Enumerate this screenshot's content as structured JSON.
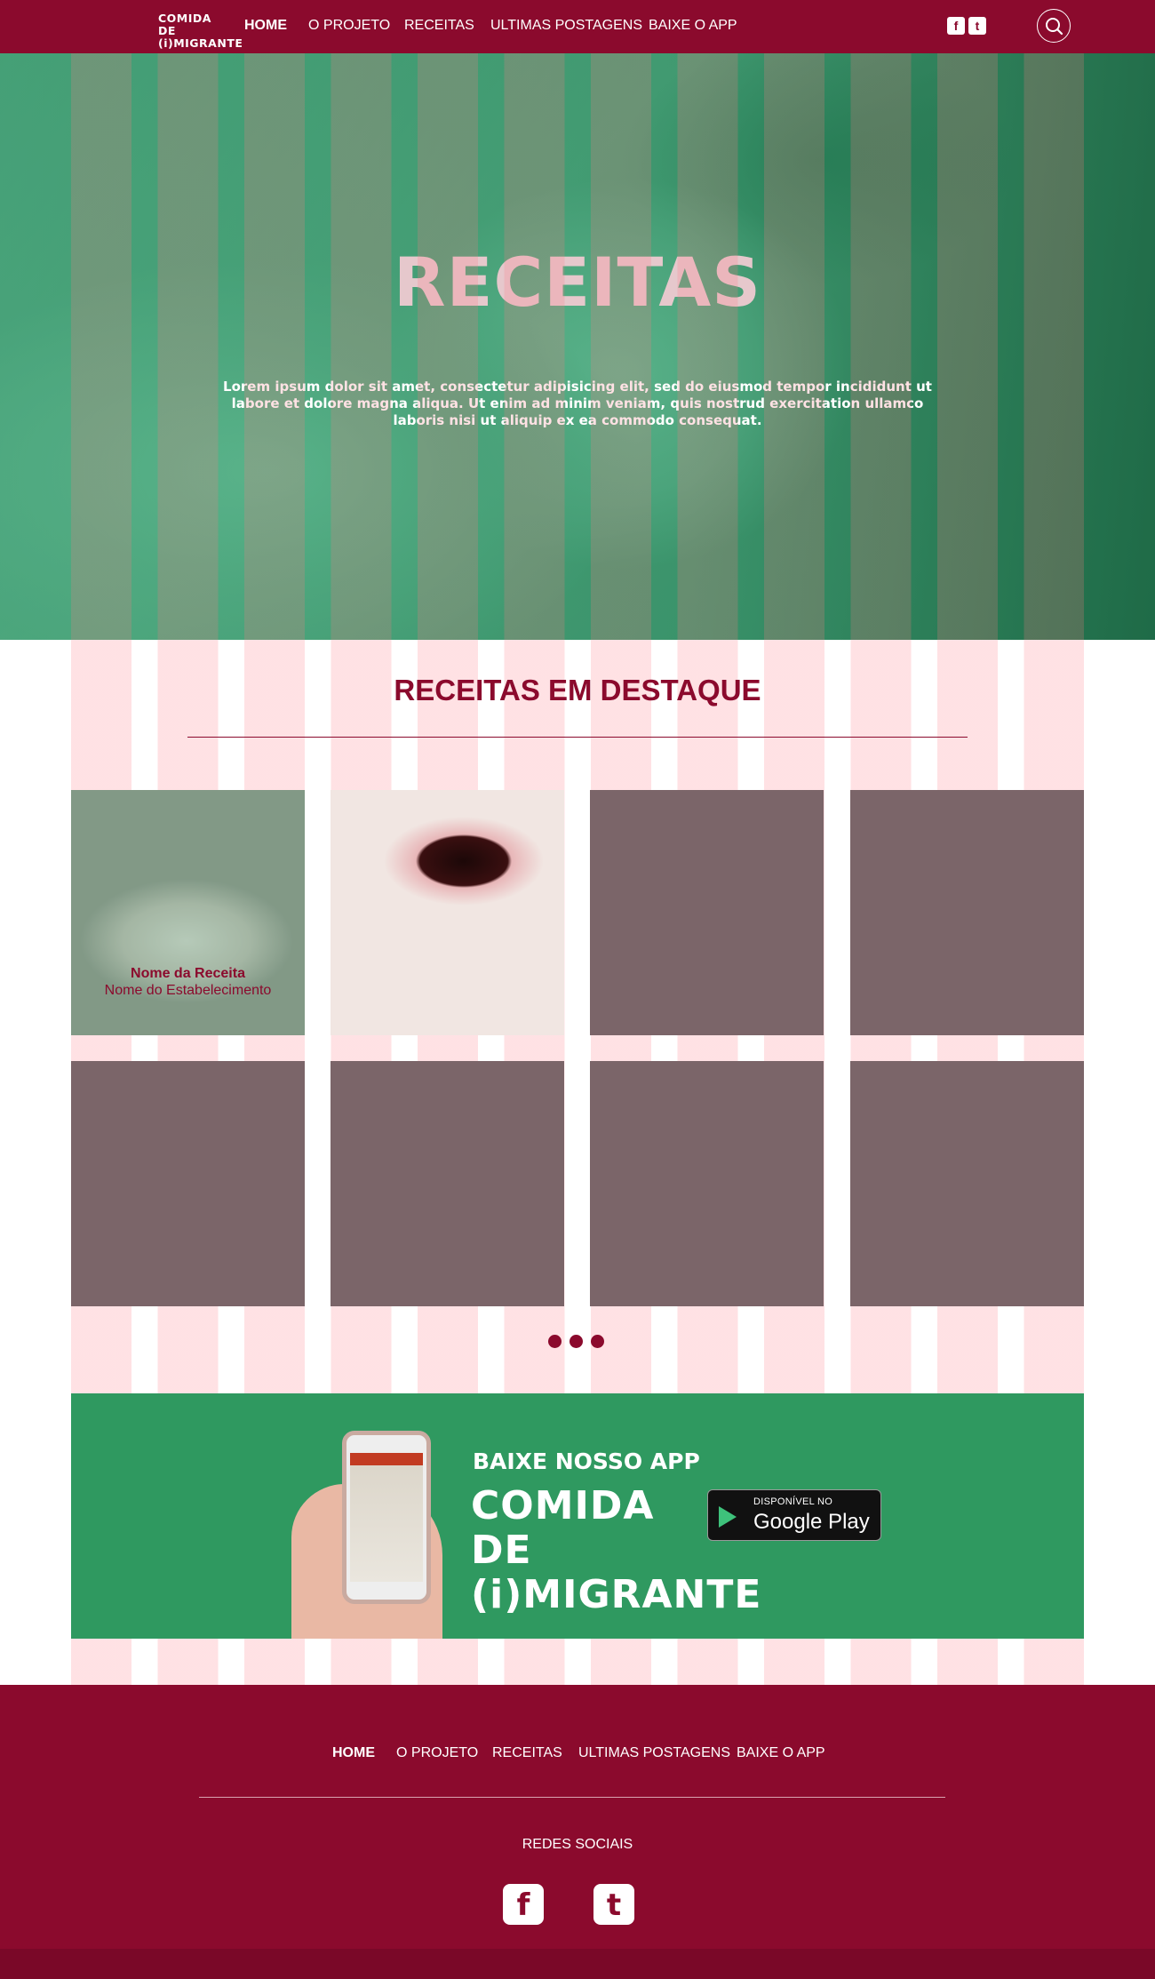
{
  "brand": {
    "logo_line1": "COMIDA DE",
    "logo_line2": "(i)MIGRANTE"
  },
  "nav": {
    "items": [
      "HOME",
      "O PROJETO",
      "RECEITAS",
      "ULTIMAS POSTAGENS",
      "BAIXE O APP"
    ]
  },
  "social": {
    "facebook_glyph": "f",
    "twitter_glyph": "t"
  },
  "hero": {
    "title": "RECEITAS",
    "text": "Lorem ipsum dolor sit amet, consectetur adipisicing elit, sed do eiusmod tempor incididunt ut labore et dolore magna aliqua. Ut enim ad minim veniam, quis nostrud exercitation ullamco laboris nisi ut aliquip ex ea commodo consequat."
  },
  "featured": {
    "title": "RECEITAS EM DESTAQUE",
    "first_card": {
      "name": "Nome da Receita",
      "place": "Nome do Estabelecimento"
    }
  },
  "app": {
    "heading": "BAIXE NOSSO APP",
    "logo_line1": "COMIDA DE",
    "logo_line2": "(i)MIGRANTE",
    "store_small": "DISPONÍVEL NO",
    "store_big": "Google Play"
  },
  "footer": {
    "nav": [
      "HOME",
      "O PROJETO",
      "RECEITAS",
      "ULTIMAS POSTAGENS",
      "BAIXE O APP"
    ],
    "social_label": "REDES SOCIAIS",
    "facebook_glyph": "f",
    "twitter_glyph": "t"
  },
  "colors": {
    "primary": "#8b0a2d",
    "green": "#2f9960",
    "placeholder": "#7b6569"
  },
  "icons": [
    "facebook-icon",
    "twitter-icon",
    "search-icon",
    "google-play-icon"
  ]
}
